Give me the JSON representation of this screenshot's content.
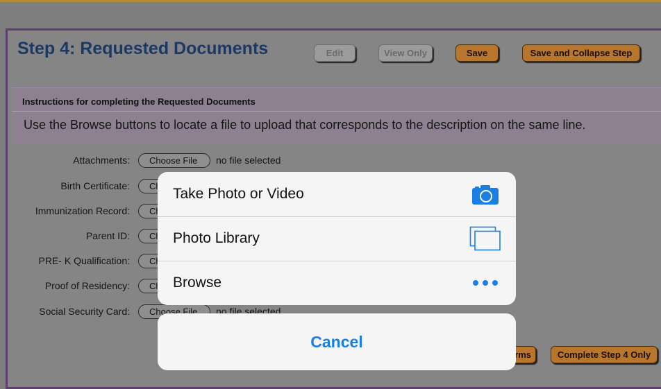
{
  "step": {
    "title": "Step 4: Requested Documents",
    "edit_label": "Edit",
    "view_only_label": "View Only",
    "save_label": "Save",
    "save_collapse_label": "Save and Collapse Step"
  },
  "instructions": {
    "heading": "Instructions for completing the Requested Documents",
    "text": "Use the Browse buttons to locate a file to upload that corresponds to the description on the same line."
  },
  "documents": [
    {
      "label": "Attachments:",
      "button": "Choose File",
      "status": "no file selected"
    },
    {
      "label": "Birth Certificate:",
      "button": "Ch"
    },
    {
      "label": "Immunization Record:",
      "button": "Ch"
    },
    {
      "label": "Parent ID:",
      "button": "Ch"
    },
    {
      "label": "PRE- K Qualification:",
      "button": "Ch"
    },
    {
      "label": "Proof of Residency:",
      "button": "Ch"
    },
    {
      "label": "Social Security Card:",
      "button": "Choose File",
      "status": "no file selected"
    }
  ],
  "footer": {
    "forms_partial": "rms",
    "complete_label": "Complete Step 4 Only"
  },
  "action_sheet": {
    "items": [
      {
        "label": "Take Photo or Video",
        "icon": "camera-icon"
      },
      {
        "label": "Photo Library",
        "icon": "photo-library-icon"
      },
      {
        "label": "Browse",
        "icon": "more-icon"
      }
    ],
    "cancel_label": "Cancel"
  },
  "colors": {
    "accent": "#1a7fe5",
    "orange_button": "#b7762c",
    "title": "#1c3966"
  }
}
